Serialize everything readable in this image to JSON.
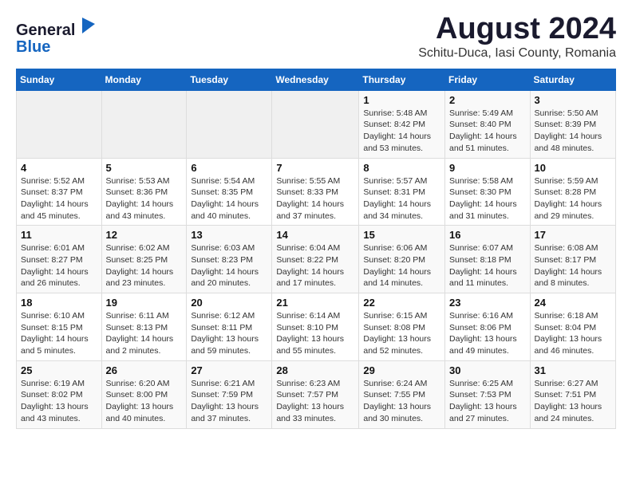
{
  "header": {
    "logo_general": "General",
    "logo_blue": "Blue",
    "main_title": "August 2024",
    "subtitle": "Schitu-Duca, Iasi County, Romania"
  },
  "days_of_week": [
    "Sunday",
    "Monday",
    "Tuesday",
    "Wednesday",
    "Thursday",
    "Friday",
    "Saturday"
  ],
  "weeks": [
    [
      {
        "day": "",
        "detail": ""
      },
      {
        "day": "",
        "detail": ""
      },
      {
        "day": "",
        "detail": ""
      },
      {
        "day": "",
        "detail": ""
      },
      {
        "day": "1",
        "detail": "Sunrise: 5:48 AM\nSunset: 8:42 PM\nDaylight: 14 hours\nand 53 minutes."
      },
      {
        "day": "2",
        "detail": "Sunrise: 5:49 AM\nSunset: 8:40 PM\nDaylight: 14 hours\nand 51 minutes."
      },
      {
        "day": "3",
        "detail": "Sunrise: 5:50 AM\nSunset: 8:39 PM\nDaylight: 14 hours\nand 48 minutes."
      }
    ],
    [
      {
        "day": "4",
        "detail": "Sunrise: 5:52 AM\nSunset: 8:37 PM\nDaylight: 14 hours\nand 45 minutes."
      },
      {
        "day": "5",
        "detail": "Sunrise: 5:53 AM\nSunset: 8:36 PM\nDaylight: 14 hours\nand 43 minutes."
      },
      {
        "day": "6",
        "detail": "Sunrise: 5:54 AM\nSunset: 8:35 PM\nDaylight: 14 hours\nand 40 minutes."
      },
      {
        "day": "7",
        "detail": "Sunrise: 5:55 AM\nSunset: 8:33 PM\nDaylight: 14 hours\nand 37 minutes."
      },
      {
        "day": "8",
        "detail": "Sunrise: 5:57 AM\nSunset: 8:31 PM\nDaylight: 14 hours\nand 34 minutes."
      },
      {
        "day": "9",
        "detail": "Sunrise: 5:58 AM\nSunset: 8:30 PM\nDaylight: 14 hours\nand 31 minutes."
      },
      {
        "day": "10",
        "detail": "Sunrise: 5:59 AM\nSunset: 8:28 PM\nDaylight: 14 hours\nand 29 minutes."
      }
    ],
    [
      {
        "day": "11",
        "detail": "Sunrise: 6:01 AM\nSunset: 8:27 PM\nDaylight: 14 hours\nand 26 minutes."
      },
      {
        "day": "12",
        "detail": "Sunrise: 6:02 AM\nSunset: 8:25 PM\nDaylight: 14 hours\nand 23 minutes."
      },
      {
        "day": "13",
        "detail": "Sunrise: 6:03 AM\nSunset: 8:23 PM\nDaylight: 14 hours\nand 20 minutes."
      },
      {
        "day": "14",
        "detail": "Sunrise: 6:04 AM\nSunset: 8:22 PM\nDaylight: 14 hours\nand 17 minutes."
      },
      {
        "day": "15",
        "detail": "Sunrise: 6:06 AM\nSunset: 8:20 PM\nDaylight: 14 hours\nand 14 minutes."
      },
      {
        "day": "16",
        "detail": "Sunrise: 6:07 AM\nSunset: 8:18 PM\nDaylight: 14 hours\nand 11 minutes."
      },
      {
        "day": "17",
        "detail": "Sunrise: 6:08 AM\nSunset: 8:17 PM\nDaylight: 14 hours\nand 8 minutes."
      }
    ],
    [
      {
        "day": "18",
        "detail": "Sunrise: 6:10 AM\nSunset: 8:15 PM\nDaylight: 14 hours\nand 5 minutes."
      },
      {
        "day": "19",
        "detail": "Sunrise: 6:11 AM\nSunset: 8:13 PM\nDaylight: 14 hours\nand 2 minutes."
      },
      {
        "day": "20",
        "detail": "Sunrise: 6:12 AM\nSunset: 8:11 PM\nDaylight: 13 hours\nand 59 minutes."
      },
      {
        "day": "21",
        "detail": "Sunrise: 6:14 AM\nSunset: 8:10 PM\nDaylight: 13 hours\nand 55 minutes."
      },
      {
        "day": "22",
        "detail": "Sunrise: 6:15 AM\nSunset: 8:08 PM\nDaylight: 13 hours\nand 52 minutes."
      },
      {
        "day": "23",
        "detail": "Sunrise: 6:16 AM\nSunset: 8:06 PM\nDaylight: 13 hours\nand 49 minutes."
      },
      {
        "day": "24",
        "detail": "Sunrise: 6:18 AM\nSunset: 8:04 PM\nDaylight: 13 hours\nand 46 minutes."
      }
    ],
    [
      {
        "day": "25",
        "detail": "Sunrise: 6:19 AM\nSunset: 8:02 PM\nDaylight: 13 hours\nand 43 minutes."
      },
      {
        "day": "26",
        "detail": "Sunrise: 6:20 AM\nSunset: 8:00 PM\nDaylight: 13 hours\nand 40 minutes."
      },
      {
        "day": "27",
        "detail": "Sunrise: 6:21 AM\nSunset: 7:59 PM\nDaylight: 13 hours\nand 37 minutes."
      },
      {
        "day": "28",
        "detail": "Sunrise: 6:23 AM\nSunset: 7:57 PM\nDaylight: 13 hours\nand 33 minutes."
      },
      {
        "day": "29",
        "detail": "Sunrise: 6:24 AM\nSunset: 7:55 PM\nDaylight: 13 hours\nand 30 minutes."
      },
      {
        "day": "30",
        "detail": "Sunrise: 6:25 AM\nSunset: 7:53 PM\nDaylight: 13 hours\nand 27 minutes."
      },
      {
        "day": "31",
        "detail": "Sunrise: 6:27 AM\nSunset: 7:51 PM\nDaylight: 13 hours\nand 24 minutes."
      }
    ]
  ]
}
